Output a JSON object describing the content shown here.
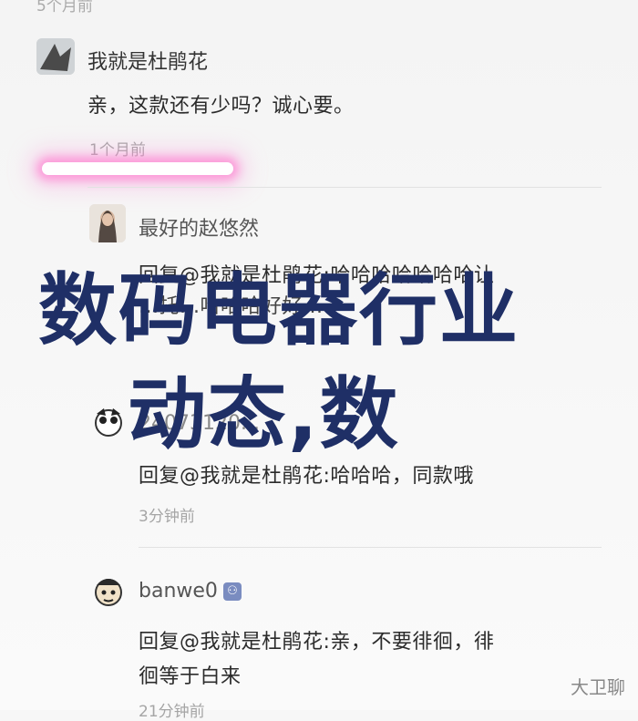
{
  "top_fragment": "5个月前",
  "comment": {
    "author": "我就是杜鹃花",
    "text": "亲，这款还有少吗？诚心要。",
    "time": "1个月前"
  },
  "replies": [
    {
      "author": "最好的赵悠然",
      "text_line1": "回复@我就是杜鹃花:哈哈哈哈哈哈哈让",
      "text_line2": "...托...哈哈哈好好..."
    },
    {
      "author": "24073120...",
      "text": "回复@我就是杜鹃花:哈哈哈，同款哦",
      "time": "3分钟前"
    },
    {
      "author": "banwe0",
      "text_line1": "回复@我就是杜鹃花:亲，不要徘徊，徘",
      "text_line2": "徊等于白来",
      "time": "21分钟前"
    }
  ],
  "overlay_title": {
    "line1": "数码电器行业",
    "line2": "动态,数"
  },
  "watermark": "大卫聊"
}
